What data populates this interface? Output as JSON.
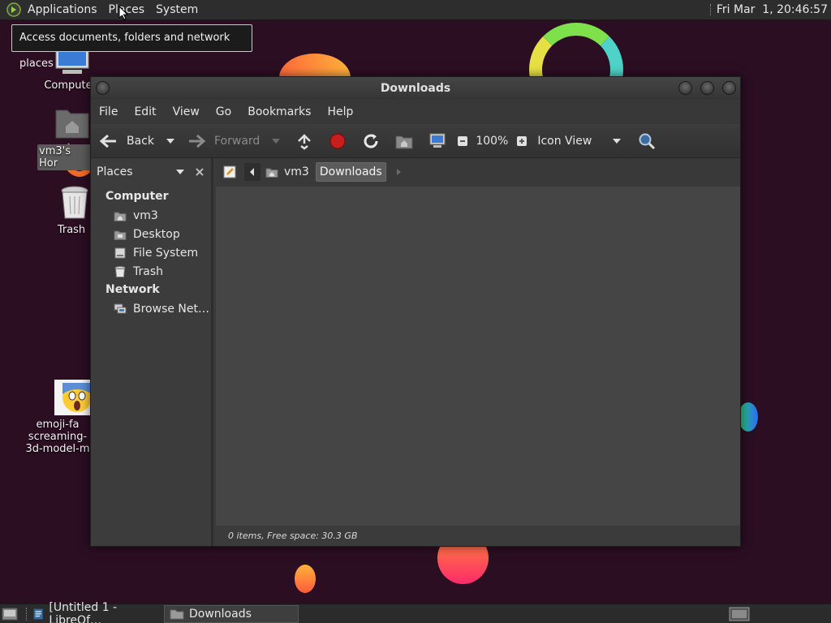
{
  "top_panel": {
    "menus": [
      "Applications",
      "Places",
      "System"
    ],
    "clock": "Fri Mar  1, 20:46:57"
  },
  "tooltip": {
    "text": "Access documents, folders and network places"
  },
  "desktop_icons": [
    {
      "label": "Compute",
      "icon": "computer-icon"
    },
    {
      "label": "vm3's Hor",
      "icon": "home-folder-icon"
    },
    {
      "label": "Trash",
      "icon": "trash-icon"
    },
    {
      "label_lines": [
        "emoji-fa",
        "screaming-",
        "3d-model-m"
      ],
      "icon": "emoji-image-icon"
    }
  ],
  "window": {
    "title": "Downloads",
    "menu": [
      "File",
      "Edit",
      "View",
      "Go",
      "Bookmarks",
      "Help"
    ],
    "toolbar": {
      "back": "Back",
      "forward": "Forward",
      "zoom": "100%",
      "view_mode": "Icon View"
    },
    "sidebar": {
      "selector": "Places",
      "sections": [
        {
          "title": "Computer",
          "items": [
            {
              "label": "vm3",
              "icon": "home-icon"
            },
            {
              "label": "Desktop",
              "icon": "desktop-icon"
            },
            {
              "label": "File System",
              "icon": "drive-icon"
            },
            {
              "label": "Trash",
              "icon": "trash-icon"
            }
          ]
        },
        {
          "title": "Network",
          "items": [
            {
              "label": "Browse Net…",
              "icon": "network-icon"
            }
          ]
        }
      ]
    },
    "path": [
      "vm3",
      "Downloads"
    ],
    "status": "0 items, Free space: 30.3 GB"
  },
  "taskbar": {
    "tasks": [
      {
        "label": "[Untitled 1 - LibreOf…",
        "active": false
      },
      {
        "label": "Downloads",
        "active": true
      }
    ]
  },
  "colors": {
    "desktop_bg": "#2b0e22",
    "window_bg": "#3a3a3a",
    "view_bg": "#454545",
    "accent_red": "#c81e1e"
  }
}
